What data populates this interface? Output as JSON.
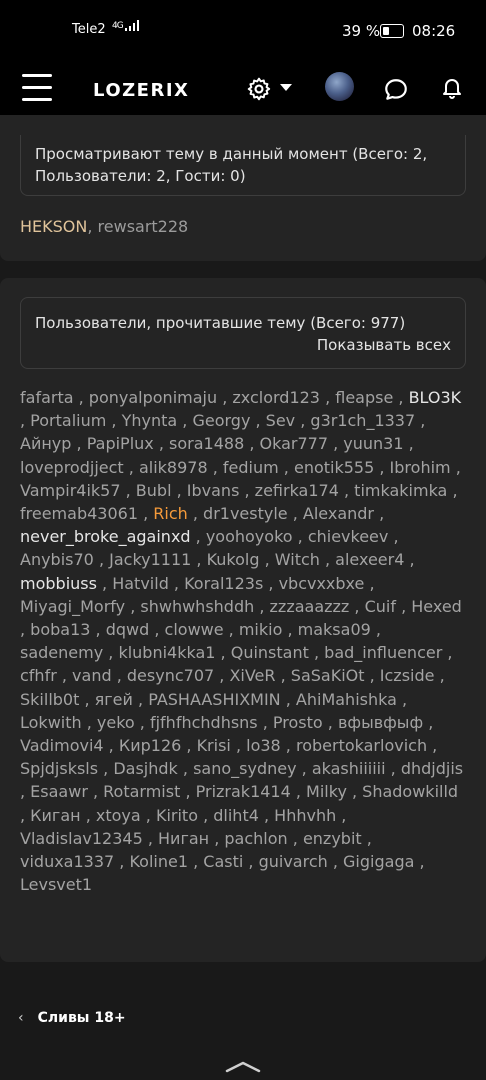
{
  "status_bar": {
    "carrier": "Tele2",
    "network": "4G",
    "battery_percent": "39 %",
    "time": "08:26"
  },
  "navbar": {
    "logo": "LOZERIX",
    "icons": [
      "menu-icon",
      "gear-icon",
      "chevron-down-icon",
      "avatar",
      "chat-icon",
      "bell-icon"
    ]
  },
  "viewing_now": {
    "title": "Просматривают тему в данный момент (Всего: 2, Пользователи: 2, Гости: 0)",
    "users": [
      "HEKSON",
      "rewsart228"
    ],
    "separator": ", "
  },
  "readers": {
    "title": "Пользователи, прочитавшие тему (Всего: 977)",
    "show_all": "Показывать всех",
    "users": [
      "fafarta",
      "ponyalponimaju",
      "zxclord123",
      "fleapse",
      "BLO3K",
      "Portalium",
      "Yhynta",
      "Georgy",
      "Sev",
      "g3r1ch_1337",
      "Айнур",
      "PapiPlux",
      "sora1488",
      "Okar777",
      "yuun31",
      "loveprodjject",
      "alik8978",
      "fedium",
      "enotik555",
      "Ibrohim",
      "Vampir4ik57",
      "Bubl",
      "Ibvans",
      "zefirka174",
      "timkakimka",
      "freemab43061",
      "Rich",
      "dr1vestyle",
      "Alexandr",
      "never_broke_againxd",
      "yoohoyoko",
      "chievkeev",
      "Anybis70",
      "Jacky1111",
      "Kukolg",
      "Witch",
      "alexeer4",
      "mobbiuss",
      "Hatvild",
      "Koral123s",
      "vbcvxxbxe",
      "Miyagi_Morfy",
      "shwhwhshddh",
      "zzzaaazzz",
      "Cuif",
      "Hexed",
      "boba13",
      "dqwd",
      "clowwe",
      "mikio",
      "maksa09",
      "sadenemy",
      "klubni4kka1",
      "Quinstant",
      "bad_influencer",
      "cfhfr",
      "vand",
      "desync707",
      "XiVeR",
      "SaSaKiOt",
      "Iczside",
      "Skillb0t",
      "ягей",
      "PASHAASHIXMIN",
      "AhiMahishka",
      "Lokwith",
      "yeko",
      "fjfhfhchdhsns",
      "Prosto",
      "вфывфыф",
      "Vadimovi4",
      "Кир126",
      "Krisi",
      "lo38",
      "robertokarlovich",
      "Spjdjsksls",
      "Dasjhdk",
      "sano_sydney",
      "akashiiiiii",
      "dhdjdjis",
      "Esaawr",
      "Rotarmist",
      "Prizrak1414",
      "Milky",
      "Shadowkilld",
      "Киган",
      "xtoya",
      "Kirito",
      "dliht4",
      "Hhhvhh",
      "Vladislav12345",
      "Ниган",
      "pachlon",
      "enzybit",
      "viduxa1337",
      "Koline1",
      "Casti",
      "guivarch",
      "Gigigaga",
      "Levsvet1"
    ],
    "highlight_white": [
      "never_broke_againxd",
      "mobbiuss",
      "BLO3K"
    ],
    "highlight_orange": [
      "Rich"
    ],
    "separator": " , "
  },
  "breadcrumb": {
    "label": "Сливы 18+"
  },
  "colors": {
    "page_bg": "#191919",
    "bar_bg": "#000000",
    "card_bg": "#242424",
    "username": "#a3a3a3",
    "highlight_orange": "#f59a3a",
    "viewer_hekson": "#e0c49b"
  }
}
